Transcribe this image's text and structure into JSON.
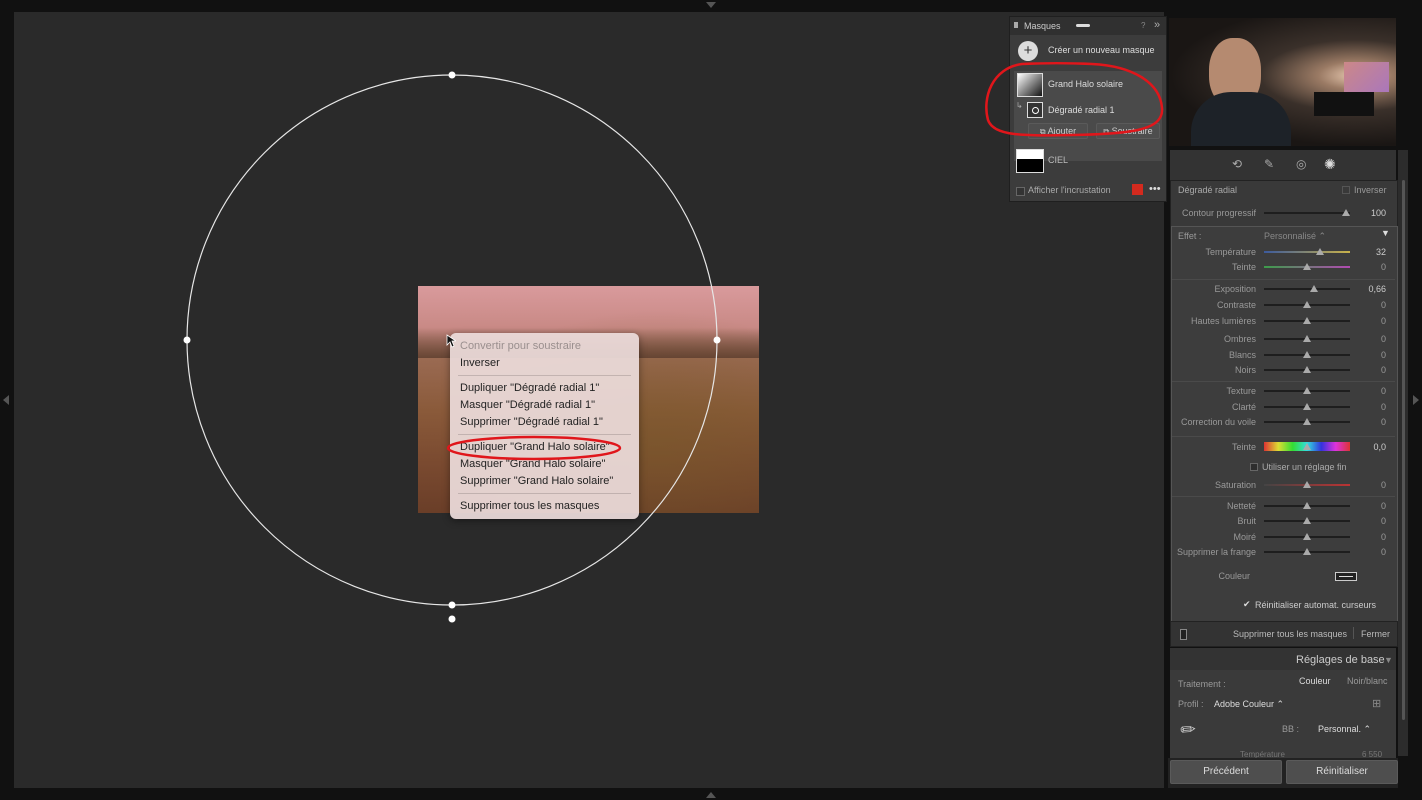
{
  "context_menu": {
    "items": [
      {
        "label": "Convertir pour soustraire",
        "disabled": true
      },
      {
        "label": "Inverser"
      },
      {
        "label": "Dupliquer \"Dégradé radial 1\""
      },
      {
        "label": "Masquer \"Dégradé radial 1\""
      },
      {
        "label": "Supprimer \"Dégradé radial 1\""
      },
      {
        "label": "Dupliquer \"Grand Halo solaire\"",
        "highlighted": true
      },
      {
        "label": "Masquer \"Grand Halo solaire\""
      },
      {
        "label": "Supprimer \"Grand Halo solaire\""
      },
      {
        "label": "Supprimer tous les masques"
      }
    ]
  },
  "masks_panel": {
    "title": "Masques",
    "create_label": "Créer un nouveau masque",
    "masks": [
      {
        "name": "Grand Halo solaire",
        "sub": "Dégradé radial 1"
      },
      {
        "name": "CIEL"
      }
    ],
    "add_label": "Ajouter",
    "subtract_label": "Soustraire",
    "overlay_label": "Afficher l'incrustation",
    "overlay_color": "#d42a1e"
  },
  "mask_settings": {
    "tool_name": "Dégradé radial",
    "invert_label": "Inverser",
    "feather_label": "Contour progressif",
    "feather_value": "100",
    "feather_level": 100,
    "effect_label": "Effet :",
    "effect_value": "Personnalisé",
    "sliders": [
      {
        "label": "Température",
        "value": "32",
        "pos": 0.65
      },
      {
        "label": "Teinte",
        "value": "0",
        "pos": 0.5
      },
      {
        "label": "Exposition",
        "value": "0,66",
        "pos": 0.58
      },
      {
        "label": "Contraste",
        "value": "0",
        "pos": 0.5
      },
      {
        "label": "Hautes lumières",
        "value": "0",
        "pos": 0.5
      },
      {
        "label": "Ombres",
        "value": "0",
        "pos": 0.5
      },
      {
        "label": "Blancs",
        "value": "0",
        "pos": 0.5
      },
      {
        "label": "Noirs",
        "value": "0",
        "pos": 0.5
      },
      {
        "label": "Texture",
        "value": "0",
        "pos": 0.5
      },
      {
        "label": "Clarté",
        "value": "0",
        "pos": 0.5
      },
      {
        "label": "Correction du voile",
        "value": "0",
        "pos": 0.5
      },
      {
        "label": "Teinte",
        "value": "0,0",
        "pos": 0.5
      },
      {
        "label": "Saturation",
        "value": "0",
        "pos": 0.5
      },
      {
        "label": "Netteté",
        "value": "0",
        "pos": 0.5
      },
      {
        "label": "Bruit",
        "value": "0",
        "pos": 0.5
      },
      {
        "label": "Moiré",
        "value": "0",
        "pos": 0.5
      },
      {
        "label": "Supprimer la frange",
        "value": "0",
        "pos": 0.5
      }
    ],
    "fine_label": "Utiliser un réglage fin",
    "color_label": "Couleur",
    "reset_label": "Réinitialiser automat. curseurs",
    "delete_all_label": "Supprimer tous les masques",
    "close_label": "Fermer"
  },
  "basic": {
    "title": "Réglages de base",
    "treatment_label": "Traitement :",
    "color_label": "Couleur",
    "bw_label": "Noir/blanc",
    "profile_label": "Profil :",
    "profile_value": "Adobe Couleur",
    "wb_label": "BB :",
    "wb_value": "Personnal.",
    "temp_label": "Température",
    "temp_value": "6 550"
  },
  "footer": {
    "prev_label": "Précédent",
    "reset_label": "Réinitialiser"
  }
}
